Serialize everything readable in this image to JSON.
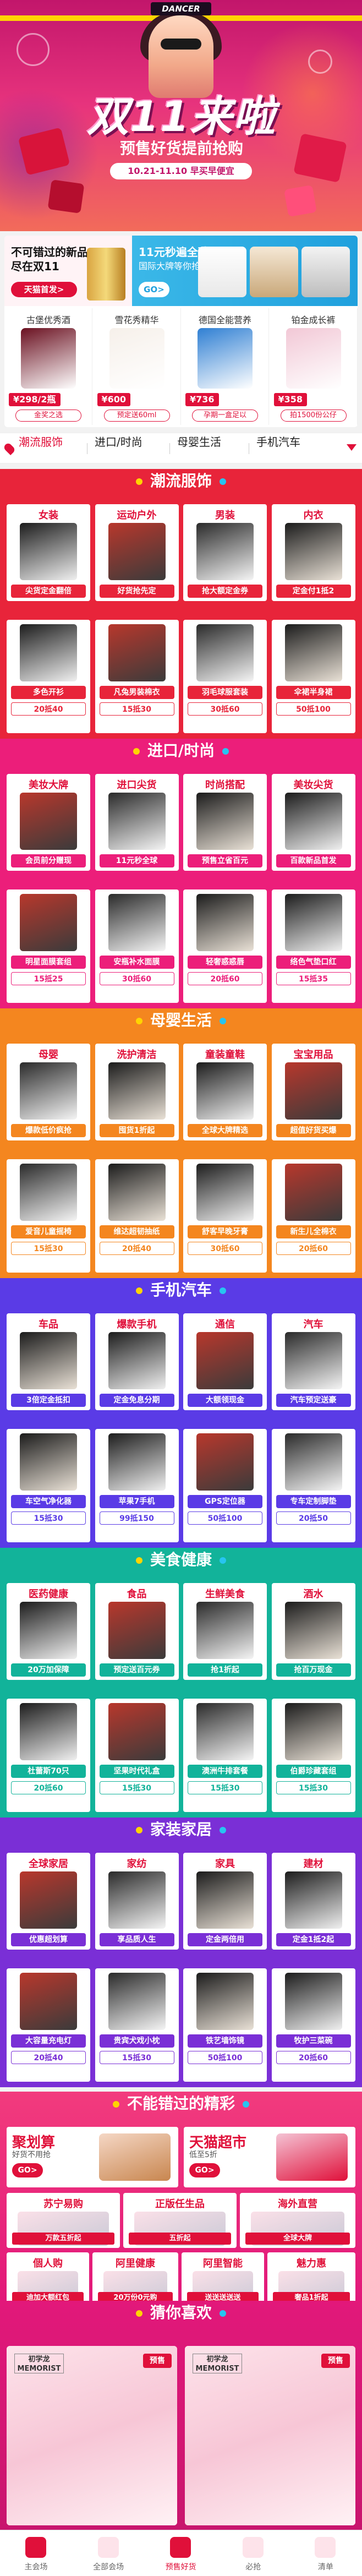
{
  "hero": {
    "badge": "DANCER",
    "title": "双11来啦",
    "subtitle": "预售好货提前抢购",
    "dates": "10.21-11.10 早买早便宜"
  },
  "promo": {
    "left": {
      "line1": "不可错过的新品",
      "line2": "尽在双11",
      "button": "天猫首发>"
    },
    "right": {
      "title": "11元秒遍全球",
      "subtitle": "国际大牌等你抢",
      "button": "GO>"
    },
    "cells": [
      {
        "name": "古堡优秀酒",
        "price": "¥298/2瓶",
        "tag": "金奖之选"
      },
      {
        "name": "雪花秀精华",
        "price": "¥600",
        "tag": "预定送60ml"
      },
      {
        "name": "德国全能营养",
        "price": "¥736",
        "tag": "孕期一盒足以"
      },
      {
        "name": "铂金成长裤",
        "price": "¥358",
        "tag": "拍1500份公仔"
      }
    ]
  },
  "nav": {
    "items": [
      "潮流服饰",
      "进口/时尚",
      "母婴生活",
      "手机汽车"
    ],
    "active": 0
  },
  "sections": [
    {
      "title": "潮流服饰",
      "color": "#e8243a",
      "cards": [
        {
          "label": "女装",
          "pill": "尖货定金翻倍"
        },
        {
          "label": "运动户外",
          "pill": "好货抢先定"
        },
        {
          "label": "男装",
          "pill": "抢大额定金券"
        },
        {
          "label": "内衣",
          "pill": "定金付1抵2"
        },
        {
          "label": "",
          "pill": "多色开衫"
        },
        {
          "label": "",
          "pill": "凡兔男装棉衣"
        },
        {
          "label": "",
          "pill": "羽毛球服套装"
        },
        {
          "label": "",
          "pill": "伞裙半身裙"
        },
        {
          "label": "",
          "pill": "20抵40"
        },
        {
          "label": "",
          "pill": "15抵30"
        },
        {
          "label": "",
          "pill": "30抵60"
        },
        {
          "label": "",
          "pill": "50抵100"
        }
      ]
    },
    {
      "title": "进口/时尚",
      "color": "#ec1e7a",
      "cards": [
        {
          "label": "美妆大牌",
          "pill": "会员前分赠现"
        },
        {
          "label": "进口尖货",
          "pill": "11元秒全球"
        },
        {
          "label": "时尚搭配",
          "pill": "预售立省百元"
        },
        {
          "label": "美妆尖货",
          "pill": "百款新品首发"
        },
        {
          "label": "",
          "pill": "明星面膜套组"
        },
        {
          "label": "",
          "pill": "安瓶补水面膜"
        },
        {
          "label": "",
          "pill": "轻奢惑惑唇"
        },
        {
          "label": "",
          "pill": "络色气垫口红"
        },
        {
          "label": "",
          "pill": "15抵25"
        },
        {
          "label": "",
          "pill": "30抵60"
        },
        {
          "label": "",
          "pill": "20抵60"
        },
        {
          "label": "",
          "pill": "15抵35"
        }
      ]
    },
    {
      "title": "母婴生活",
      "color": "#f4861f",
      "cards": [
        {
          "label": "母婴",
          "pill": "爆款低价疯抢"
        },
        {
          "label": "洗护清洁",
          "pill": "囤货1折起"
        },
        {
          "label": "童装童鞋",
          "pill": "全球大牌精选"
        },
        {
          "label": "宝宝用品",
          "pill": "超值好货买爆"
        },
        {
          "label": "",
          "pill": "爱音儿童摇椅"
        },
        {
          "label": "",
          "pill": "维达超韧抽纸"
        },
        {
          "label": "",
          "pill": "舒客早晚牙膏"
        },
        {
          "label": "",
          "pill": "新生儿全棉衣"
        },
        {
          "label": "",
          "pill": "15抵30"
        },
        {
          "label": "",
          "pill": "20抵40"
        },
        {
          "label": "",
          "pill": "30抵60"
        },
        {
          "label": "",
          "pill": "20抵60"
        }
      ]
    },
    {
      "title": "手机汽车",
      "color": "#5a3be6",
      "cards": [
        {
          "label": "车品",
          "pill": "3倍定金抵扣"
        },
        {
          "label": "爆款手机",
          "pill": "定金免息分期"
        },
        {
          "label": "通信",
          "pill": "大额领现金"
        },
        {
          "label": "汽车",
          "pill": "汽车预定送豪"
        },
        {
          "label": "",
          "pill": "车空气净化器"
        },
        {
          "label": "",
          "pill": "苹果7手机"
        },
        {
          "label": "",
          "pill": "GPS定位器"
        },
        {
          "label": "",
          "pill": "专车定制脚垫"
        },
        {
          "label": "",
          "pill": "15抵30"
        },
        {
          "label": "",
          "pill": "99抵150"
        },
        {
          "label": "",
          "pill": "50抵100"
        },
        {
          "label": "",
          "pill": "20抵50"
        }
      ]
    },
    {
      "title": "美食健康",
      "color": "#12b39a",
      "cards": [
        {
          "label": "医药健康",
          "pill": "20万加保障"
        },
        {
          "label": "食品",
          "pill": "预定送百元券"
        },
        {
          "label": "生鲜美食",
          "pill": "抢1折起"
        },
        {
          "label": "酒水",
          "pill": "抢百万现金"
        },
        {
          "label": "",
          "pill": "杜蕾斯70只"
        },
        {
          "label": "",
          "pill": "坚果时代礼盒"
        },
        {
          "label": "",
          "pill": "澳洲牛排套餐"
        },
        {
          "label": "",
          "pill": "伯爵珍藏套组"
        },
        {
          "label": "",
          "pill": "20抵60"
        },
        {
          "label": "",
          "pill": "15抵30"
        },
        {
          "label": "",
          "pill": "15抵30"
        },
        {
          "label": "",
          "pill": "15抵30"
        }
      ]
    },
    {
      "title": "家装家居",
      "color": "#7a2fd6",
      "cards": [
        {
          "label": "全球家居",
          "pill": "优惠超划算"
        },
        {
          "label": "家纺",
          "pill": "享品质人生"
        },
        {
          "label": "家具",
          "pill": "定金两倍用"
        },
        {
          "label": "建材",
          "pill": "定金1抵2起"
        },
        {
          "label": "",
          "pill": "大容量充电灯"
        },
        {
          "label": "",
          "pill": "贵宾犬戏小枕"
        },
        {
          "label": "",
          "pill": "铁艺墙饰镜"
        },
        {
          "label": "",
          "pill": "牧护三菜碗"
        },
        {
          "label": "",
          "pill": "20抵40"
        },
        {
          "label": "",
          "pill": "15抵30"
        },
        {
          "label": "",
          "pill": "50抵100"
        },
        {
          "label": "",
          "pill": "20抵60"
        }
      ]
    }
  ],
  "must_see": {
    "title": "不能错过的精彩",
    "big": [
      {
        "title": "聚划算",
        "sub": "好货不用抢",
        "button": "GO>"
      },
      {
        "title": "天猫超市",
        "sub": "低至5折",
        "button": "GO>"
      }
    ],
    "small": [
      {
        "title": "苏宁易购",
        "price": "万款五折起"
      },
      {
        "title": "正版任生品",
        "price": "五折起"
      },
      {
        "title": "海外直营",
        "price": "全球大牌"
      },
      {
        "title": "個人购",
        "price": "迪加大额红包"
      },
      {
        "title": "阿里健康",
        "price": "20万份0元购"
      },
      {
        "title": "阿里智能",
        "price": "送送送送送"
      },
      {
        "title": "魅力惠",
        "price": "奢品1折起"
      }
    ]
  },
  "guess": {
    "title": "猜你喜欢",
    "items": [
      {
        "brand": "初学龙 MEMORIST",
        "tag": "预售"
      },
      {
        "brand": "初学龙 MEMORIST",
        "tag": "预售"
      }
    ]
  },
  "tabs": [
    "主会场",
    "全部会场",
    "预售好货",
    "必抢",
    "清单"
  ],
  "tab_active": 2
}
